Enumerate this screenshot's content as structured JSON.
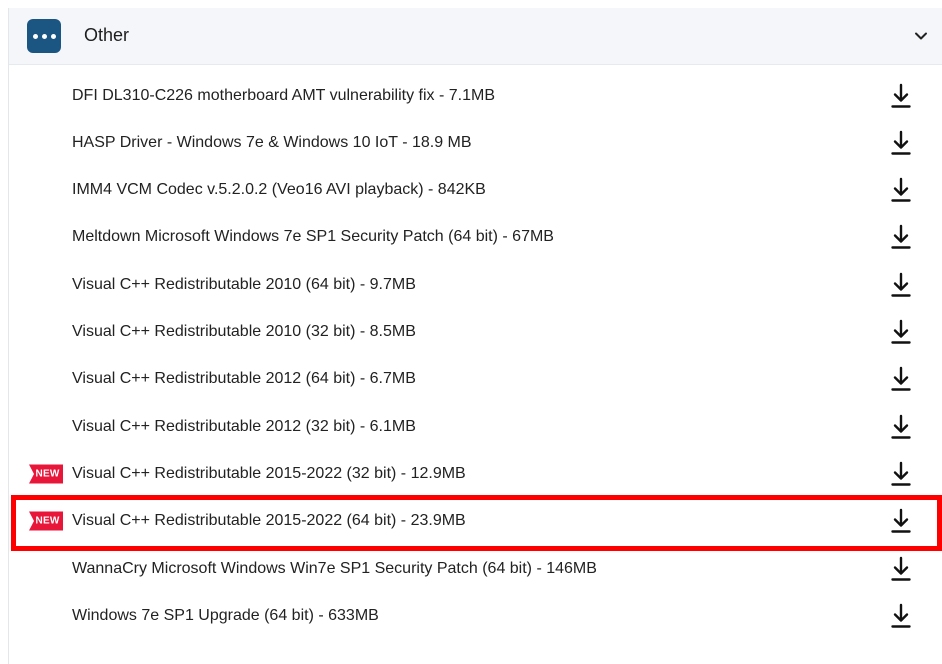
{
  "section": {
    "title": "Other",
    "icon": "more-dots-icon",
    "chevron_icon": "chevron-down-icon",
    "accent_color": "#1b5683"
  },
  "downloads": [
    {
      "label": "DFI DL310-C226 motherboard AMT vulnerability fix - 7.1MB",
      "badge": null
    },
    {
      "label": "HASP Driver - Windows 7e & Windows 10 IoT - 18.9 MB",
      "badge": null
    },
    {
      "label": "IMM4 VCM Codec v.5.2.0.2 (Veo16 AVI playback) - 842KB",
      "badge": null
    },
    {
      "label": "Meltdown Microsoft Windows 7e SP1 Security Patch (64 bit) - 67MB",
      "badge": null
    },
    {
      "label": "Visual C++ Redistributable 2010 (64 bit) - 9.7MB",
      "badge": null
    },
    {
      "label": "Visual C++ Redistributable 2010 (32 bit) - 8.5MB",
      "badge": null
    },
    {
      "label": "Visual C++ Redistributable 2012 (64 bit) - 6.7MB",
      "badge": null
    },
    {
      "label": "Visual C++ Redistributable 2012 (32 bit) - 6.1MB",
      "badge": null
    },
    {
      "label": "Visual C++ Redistributable 2015-2022 (32 bit) - 12.9MB",
      "badge": "NEW"
    },
    {
      "label": "Visual C++ Redistributable 2015-2022 (64 bit) - 23.9MB",
      "badge": "NEW",
      "highlighted": true
    },
    {
      "label": "WannaCry Microsoft Windows Win7e SP1 Security Patch (64 bit) - 146MB",
      "badge": null
    },
    {
      "label": "Windows 7e SP1 Upgrade (64 bit) - 633MB",
      "badge": null
    }
  ],
  "download_icon": "download-icon",
  "badge_color": "#e8173a",
  "highlight_color": "#ff0000"
}
